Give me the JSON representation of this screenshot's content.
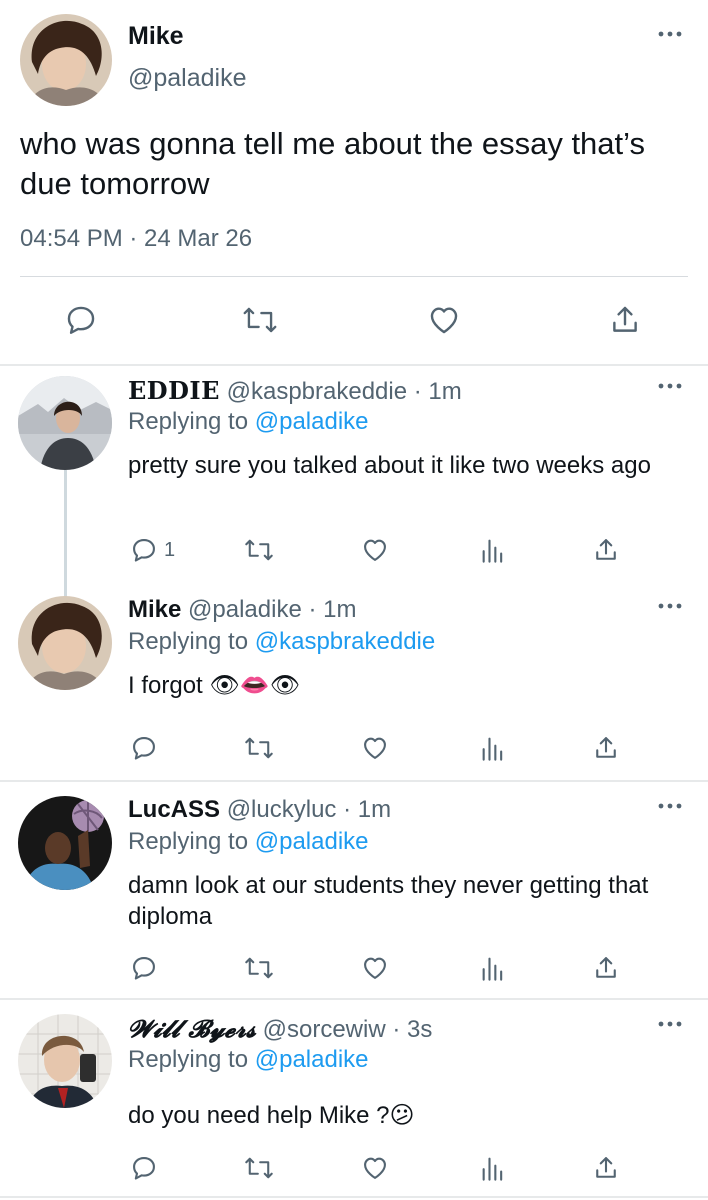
{
  "main_tweet": {
    "name": "Mike",
    "handle": "@paladike",
    "text": "who was gonna tell me about the essay that’s due tomorrow",
    "time": "04:54 PM · 24 Mar 26",
    "action_icons": [
      "reply-icon",
      "retweet-icon",
      "like-icon",
      "share-icon"
    ]
  },
  "replies": [
    {
      "display_name": "EDDIE",
      "handle": "@kaspbrakeddie",
      "time": "· 1m",
      "replying_prefix": "Replying to",
      "replying_to": "@paladike",
      "text": "pretty sure you talked about it like two weeks ago",
      "reply_count": "1"
    },
    {
      "display_name": "Mike",
      "handle": "@paladike",
      "time": "· 1m",
      "replying_prefix": "Replying to",
      "replying_to": "@kaspbrakeddie",
      "text": "I forgot 👁👄👁",
      "reply_count": ""
    },
    {
      "display_name": "LucASS",
      "handle": "@luckyluc",
      "time": "· 1m",
      "replying_prefix": "Replying to",
      "replying_to": "@paladike",
      "text": "damn look at our students they never getting that diploma",
      "reply_count": ""
    },
    {
      "display_name": "𝓦𝓲𝓵𝓵 𝓑𝔂𝓮𝓻𝓼",
      "handle": "@sorcewiw",
      "time": "· 3s",
      "replying_prefix": "Replying to",
      "replying_to": "@paladike",
      "text": "do you need help Mike ?😕",
      "reply_count": ""
    }
  ],
  "colors": {
    "text": "#0f1419",
    "muted": "#536471",
    "link": "#1d9bf0",
    "divider": "#e7e9ea"
  }
}
